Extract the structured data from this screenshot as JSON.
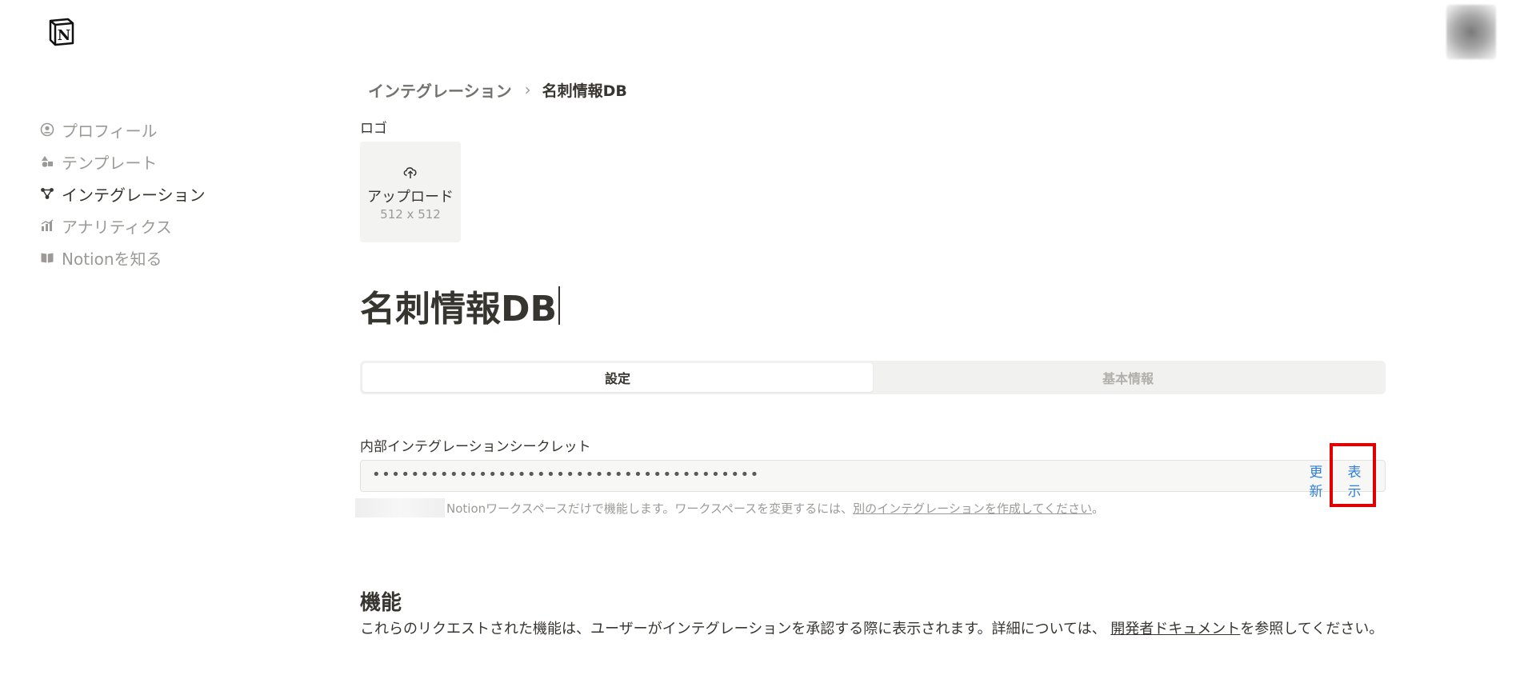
{
  "header": {
    "logo_icon": "notion-logo-icon",
    "avatar_icon": "user-avatar"
  },
  "sidebar": {
    "items": [
      {
        "label": "プロフィール",
        "icon": "user-circle-icon",
        "active": false
      },
      {
        "label": "テンプレート",
        "icon": "shapes-icon",
        "active": false
      },
      {
        "label": "インテグレーション",
        "icon": "integration-icon",
        "active": true
      },
      {
        "label": "アナリティクス",
        "icon": "analytics-icon",
        "active": false
      },
      {
        "label": "Notionを知る",
        "icon": "book-icon",
        "active": false
      }
    ]
  },
  "breadcrumb": {
    "parent": "インテグレーション",
    "separator": "›",
    "current": "名刺情報DB"
  },
  "logo_section": {
    "label": "ロゴ",
    "upload_label": "アップロード",
    "upload_size": "512 x 512"
  },
  "title": "名刺情報DB",
  "tabs": [
    {
      "label": "設定",
      "active": true
    },
    {
      "label": "基本情報",
      "active": false
    }
  ],
  "secret": {
    "label": "内部インテグレーションシークレット",
    "masked_value": "••••••••••••••••••••••••••••••••••••••••",
    "refresh_label": "更新",
    "show_label": "表示",
    "helper_text": "Notionワークスペースだけで機能します。ワークスペースを変更するには、",
    "helper_link": "別のインテグレーションを作成してください",
    "helper_suffix": "。"
  },
  "capabilities": {
    "title": "機能",
    "desc_prefix": "これらのリクエストされた機能は、ユーザーがインテグレーションを承認する際に表示されます。詳細については、 ",
    "desc_link": "開発者ドキュメント",
    "desc_suffix": "を参照してください。"
  },
  "colors": {
    "text": "#37352f",
    "muted": "#9b9a97",
    "link_blue": "#2f7ed8",
    "highlight_red": "#e00000"
  }
}
